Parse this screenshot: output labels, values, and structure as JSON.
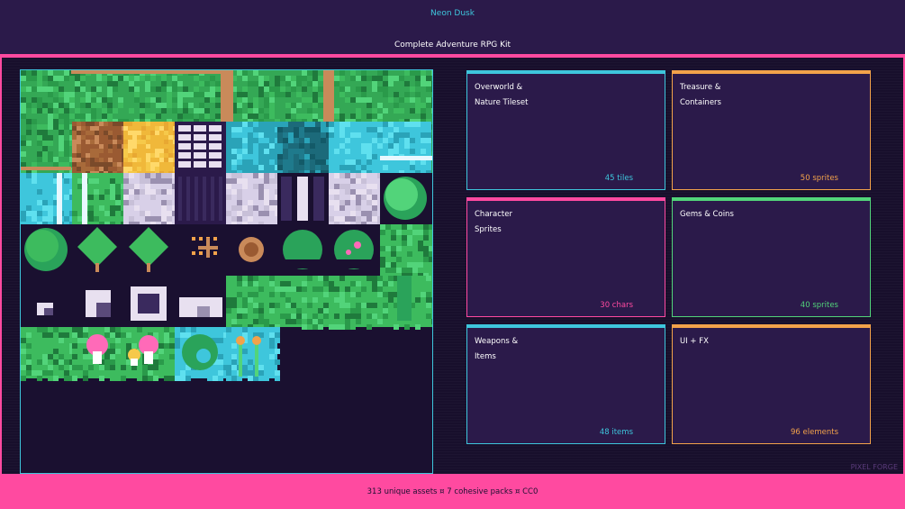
{
  "header": {
    "brand": "Neon Dusk",
    "subtitle": "Complete Adventure RPG Kit"
  },
  "cards": [
    {
      "title": "Overworld &\nNature Tileset",
      "count": "45 tiles",
      "accent": "#3ec6dc"
    },
    {
      "title": "Treasure &\nContainers",
      "count": "50 sprites",
      "accent": "#f2a24a"
    },
    {
      "title": "Character\nSprites",
      "count": "30 chars",
      "accent": "#ff4aa0"
    },
    {
      "title": "Gems & Coins",
      "count": "40 sprites",
      "accent": "#52d47a"
    },
    {
      "title": "Weapons &\nItems",
      "count": "48 items",
      "accent": "#3ec6dc"
    },
    {
      "title": "UI + FX",
      "count": "96 elements",
      "accent": "#f2a24a"
    }
  ],
  "watermark": "PIXEL FORGE",
  "footer": {
    "text": "313 unique assets ¤ 7 cohesive packs ¤ CC0"
  },
  "colors": {
    "pink": "#ff4aa0",
    "cyan": "#3ec6dc",
    "orange": "#f2a24a",
    "green": "#52d47a",
    "bg": "#2b1a4a",
    "panel": "#180f2c"
  }
}
